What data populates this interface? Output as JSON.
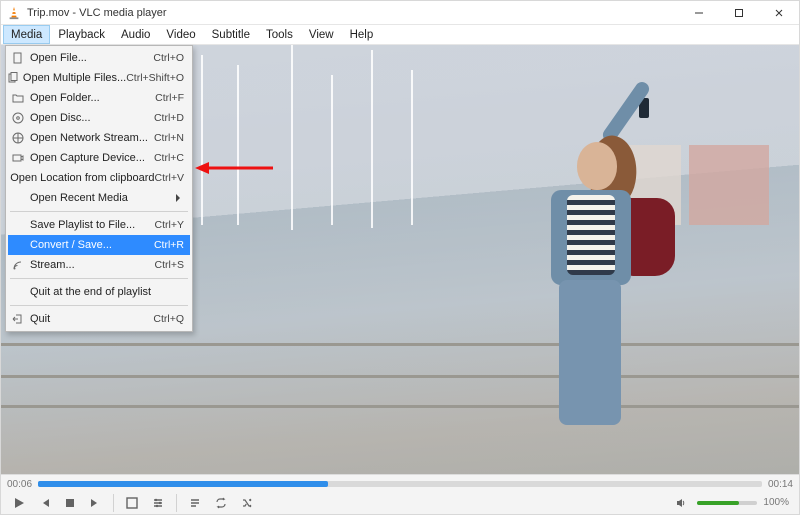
{
  "titlebar": {
    "title": "Trip.mov - VLC media player"
  },
  "menubar": {
    "items": [
      "Media",
      "Playback",
      "Audio",
      "Video",
      "Subtitle",
      "Tools",
      "View",
      "Help"
    ],
    "open_index": 0
  },
  "dropdown": {
    "groups": [
      [
        {
          "label": "Open File...",
          "shortcut": "Ctrl+O",
          "icon": "file"
        },
        {
          "label": "Open Multiple Files...",
          "shortcut": "Ctrl+Shift+O",
          "icon": "files"
        },
        {
          "label": "Open Folder...",
          "shortcut": "Ctrl+F",
          "icon": "folder"
        },
        {
          "label": "Open Disc...",
          "shortcut": "Ctrl+D",
          "icon": "disc"
        },
        {
          "label": "Open Network Stream...",
          "shortcut": "Ctrl+N",
          "icon": "network"
        },
        {
          "label": "Open Capture Device...",
          "shortcut": "Ctrl+C",
          "icon": "camera"
        },
        {
          "label": "Open Location from clipboard",
          "shortcut": "Ctrl+V"
        },
        {
          "label": "Open Recent Media",
          "submenu": true
        }
      ],
      [
        {
          "label": "Save Playlist to File...",
          "shortcut": "Ctrl+Y"
        },
        {
          "label": "Convert / Save...",
          "shortcut": "Ctrl+R",
          "highlight": true
        },
        {
          "label": "Stream...",
          "shortcut": "Ctrl+S",
          "icon": "stream"
        }
      ],
      [
        {
          "label": "Quit at the end of playlist"
        }
      ],
      [
        {
          "label": "Quit",
          "shortcut": "Ctrl+Q",
          "icon": "quit"
        }
      ]
    ]
  },
  "player": {
    "elapsed": "00:06",
    "total": "00:14",
    "volume_pct": "100%"
  }
}
